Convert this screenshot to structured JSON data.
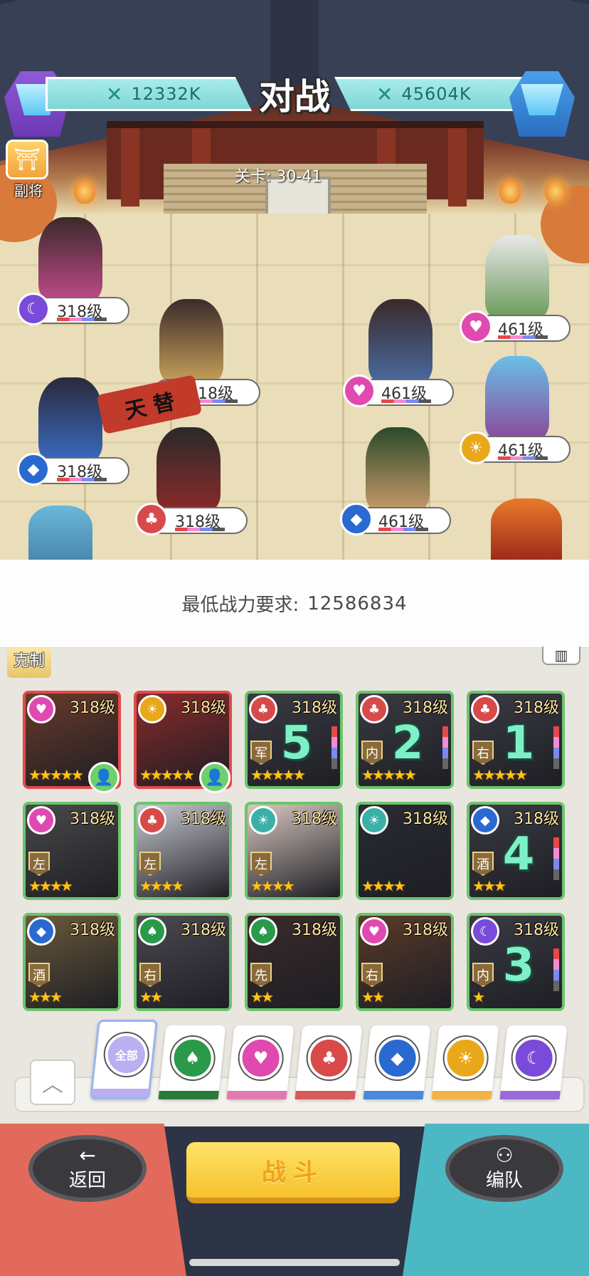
{
  "header": {
    "title": "对战",
    "left_power": "12332K",
    "right_power": "45604K",
    "stage": "关卡: 30-41",
    "deputy_label": "副将"
  },
  "allies": [
    {
      "level": "318级",
      "faction": "moon",
      "faction_color": "#7a4ad8"
    },
    {
      "level": "318级",
      "faction": "none",
      "faction_color": "#888888"
    },
    {
      "level": "318级",
      "faction": "diamond",
      "faction_color": "#2a6ad0"
    },
    {
      "level": "318级",
      "faction": "club",
      "faction_color": "#d84a4a"
    }
  ],
  "enemies": [
    {
      "level": "461级",
      "faction": "heart",
      "faction_color": "#e04ab0"
    },
    {
      "level": "461级",
      "faction": "heart",
      "faction_color": "#e04ab0"
    },
    {
      "level": "461级",
      "faction": "sun",
      "faction_color": "#e8a81a"
    },
    {
      "level": "461级",
      "faction": "diamond",
      "faction_color": "#2a6ad0"
    }
  ],
  "banner_text": "天 替",
  "requirement": {
    "label": "最低战力要求:",
    "value": "12586834"
  },
  "counter_label": "克制",
  "heroes": [
    {
      "level": "318级",
      "element": "heart",
      "element_color": "#e04ab0",
      "stars": 5,
      "role": "",
      "number": "",
      "selected": true,
      "in_team": true
    },
    {
      "level": "318级",
      "element": "sun",
      "element_color": "#e8a81a",
      "stars": 5,
      "role": "",
      "number": "",
      "selected": true,
      "in_team": true
    },
    {
      "level": "318级",
      "element": "club",
      "element_color": "#d84a4a",
      "stars": 5,
      "role": "军",
      "number": "5",
      "selected": false,
      "in_team": false
    },
    {
      "level": "318级",
      "element": "club",
      "element_color": "#d84a4a",
      "stars": 5,
      "role": "内",
      "number": "2",
      "selected": false,
      "in_team": false
    },
    {
      "level": "318级",
      "element": "club",
      "element_color": "#d84a4a",
      "stars": 5,
      "role": "右",
      "number": "1",
      "selected": false,
      "in_team": false
    },
    {
      "level": "318级",
      "element": "heart",
      "element_color": "#e04ab0",
      "stars": 4,
      "role": "左",
      "number": "",
      "selected": false,
      "in_team": false
    },
    {
      "level": "318级",
      "element": "club",
      "element_color": "#d84a4a",
      "stars": 4,
      "role": "左",
      "number": "",
      "selected": false,
      "in_team": false
    },
    {
      "level": "318级",
      "element": "sun",
      "element_color": "#3ab0a8",
      "stars": 4,
      "role": "左",
      "number": "",
      "selected": false,
      "in_team": false
    },
    {
      "level": "318级",
      "element": "sun",
      "element_color": "#3ab0a8",
      "stars": 4,
      "role": "",
      "number": "",
      "selected": false,
      "in_team": false
    },
    {
      "level": "318级",
      "element": "diamond",
      "element_color": "#2a6ad0",
      "stars": 3,
      "role": "酒",
      "number": "4",
      "selected": false,
      "in_team": false
    },
    {
      "level": "318级",
      "element": "diamond",
      "element_color": "#2a6ad0",
      "stars": 3,
      "role": "酒",
      "number": "",
      "selected": false,
      "in_team": false
    },
    {
      "level": "318级",
      "element": "spade",
      "element_color": "#2a9a4a",
      "stars": 2,
      "role": "右",
      "number": "",
      "selected": false,
      "in_team": false
    },
    {
      "level": "318级",
      "element": "spade",
      "element_color": "#2a9a4a",
      "stars": 2,
      "role": "先",
      "number": "",
      "selected": false,
      "in_team": false
    },
    {
      "level": "318级",
      "element": "heart",
      "element_color": "#e04ab0",
      "stars": 2,
      "role": "右",
      "number": "",
      "selected": false,
      "in_team": false
    },
    {
      "level": "318级",
      "element": "moon",
      "element_color": "#7a4ad8",
      "stars": 1,
      "role": "内",
      "number": "3",
      "selected": false,
      "in_team": false
    }
  ],
  "filters": [
    {
      "name": "all",
      "label": "全部",
      "color": "#b8b0f0",
      "stripe": "#b8b0f0",
      "active": true
    },
    {
      "name": "spade",
      "label": "♠",
      "color": "#2a9a4a",
      "stripe": "#2a7a3a",
      "active": false
    },
    {
      "name": "heart",
      "label": "♥",
      "color": "#e04ab0",
      "stripe": "#e07ab0",
      "active": false
    },
    {
      "name": "club",
      "label": "♣",
      "color": "#d84a4a",
      "stripe": "#d85a5a",
      "active": false
    },
    {
      "name": "diamond",
      "label": "◆",
      "color": "#2a6ad0",
      "stripe": "#4a8ad8",
      "active": false
    },
    {
      "name": "sun",
      "label": "☀",
      "color": "#e8a81a",
      "stripe": "#f2b24a",
      "active": false
    },
    {
      "name": "moon",
      "label": "☾",
      "color": "#7a4ad8",
      "stripe": "#9a6ad8",
      "active": false
    }
  ],
  "bottom": {
    "back_label": "返回",
    "fight_label": "战斗",
    "team_label": "编队"
  },
  "icons": {
    "sword": "sword-icon",
    "back_arrow": "←",
    "team": "team-icon",
    "up": "chevron-up-icon"
  }
}
